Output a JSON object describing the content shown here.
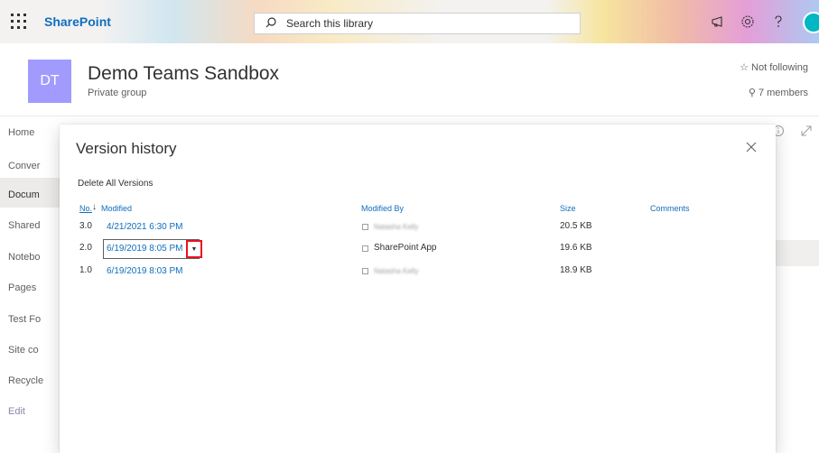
{
  "suitebar": {
    "brand": "SharePoint",
    "search_placeholder": "Search this library"
  },
  "site": {
    "logo_initials": "DT",
    "title": "Demo Teams Sandbox",
    "subtitle": "Private group",
    "follow_label": "Not following",
    "members_label": "7 members"
  },
  "leftnav": {
    "items": [
      "Home",
      "Conver",
      "Docum",
      "Shared",
      "Notebo",
      "Pages",
      "Test Fo",
      "Site co",
      "Recycle"
    ],
    "edit_label": "Edit"
  },
  "dialog": {
    "title": "Version history",
    "delete_all": "Delete All Versions",
    "columns": {
      "no": "No.",
      "modified": "Modified",
      "modified_by": "Modified By",
      "size": "Size",
      "comments": "Comments"
    },
    "rows": [
      {
        "no": "3.0",
        "modified": "4/21/2021 6:30 PM",
        "modified_by": "Natasha Kelly",
        "size": "20.5 KB",
        "comments": ""
      },
      {
        "no": "2.0",
        "modified": "6/19/2019 8:05 PM",
        "modified_by": "SharePoint App",
        "size": "19.6 KB",
        "comments": ""
      },
      {
        "no": "1.0",
        "modified": "6/19/2019 8:03 PM",
        "modified_by": "Natasha Kelly",
        "size": "18.9 KB",
        "comments": ""
      }
    ]
  },
  "icons": {
    "waffle": "app-launcher-icon",
    "search": "search-icon",
    "megaphone": "megaphone-icon",
    "settings": "gear-icon",
    "help": "help-icon",
    "close": "close-icon",
    "dropdown": "caret-down-icon",
    "info": "info-icon",
    "expand": "expand-icon"
  },
  "colors": {
    "brand_blue": "#106ebe",
    "site_logo": "#a29bfe",
    "highlight_red": "#e81123"
  }
}
